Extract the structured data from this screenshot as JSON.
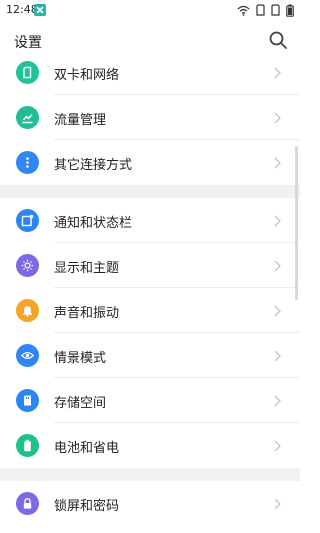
{
  "status_bar": {
    "time": "12:48",
    "app_icon": "app-icon",
    "right_icons": [
      "wifi-icon",
      "sim-icon",
      "sim-icon",
      "battery-icon"
    ]
  },
  "header": {
    "title": "设置",
    "search_icon": "search-icon"
  },
  "sections": [
    {
      "items": [
        {
          "label": "双卡和网络",
          "icon": "sim-icon",
          "color": "#21c39b"
        },
        {
          "label": "流量管理",
          "icon": "chart-icon",
          "color": "#1fbf96"
        },
        {
          "label": "其它连接方式",
          "icon": "more-icon",
          "color": "#2f86f6"
        }
      ]
    },
    {
      "items": [
        {
          "label": "通知和状态栏",
          "icon": "notification-icon",
          "color": "#2a86f4"
        },
        {
          "label": "显示和主题",
          "icon": "sun-icon",
          "color": "#7b69e6"
        },
        {
          "label": "声音和振动",
          "icon": "bell-icon",
          "color": "#f7a426"
        },
        {
          "label": "情景模式",
          "icon": "eye-icon",
          "color": "#2c86f5"
        },
        {
          "label": "存储空间",
          "icon": "storage-icon",
          "color": "#2b86f5"
        },
        {
          "label": "电池和省电",
          "icon": "battery-icon",
          "color": "#1cc18e"
        }
      ]
    },
    {
      "items": [
        {
          "label": "锁屏和密码",
          "icon": "lock-icon",
          "color": "#7c69e6"
        }
      ]
    }
  ]
}
